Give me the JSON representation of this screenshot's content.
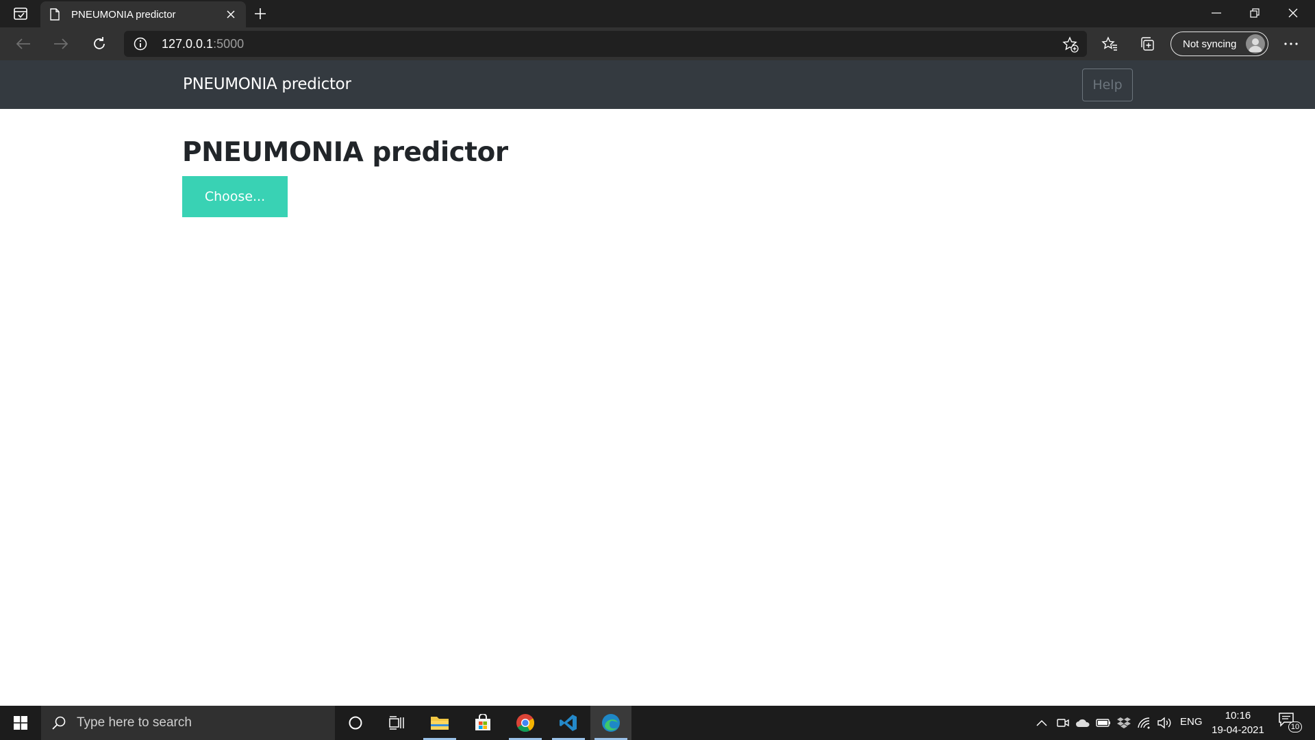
{
  "browser": {
    "tab": {
      "title": "PNEUMONIA predictor"
    },
    "address": {
      "host": "127.0.0.1",
      "port": ":5000"
    },
    "profile": {
      "label": "Not syncing"
    }
  },
  "page": {
    "navbar": {
      "brand": "PNEUMONIA predictor",
      "help_label": "Help"
    },
    "heading": "PNEUMONIA predictor",
    "choose_label": "Choose..."
  },
  "taskbar": {
    "search_placeholder": "Type here to search",
    "apps": [
      "cortana-icon",
      "task-view-icon",
      "file-explorer-icon",
      "store-icon",
      "chrome-icon",
      "vscode-icon",
      "edge-icon"
    ],
    "language": "ENG",
    "time": "10:16",
    "date": "19-04-2021",
    "notification_count": "10"
  },
  "colors": {
    "navbar_bg": "#343a40",
    "choose_button_bg": "#39d2b4",
    "heading_text": "#212529",
    "help_button": "#6c757d"
  }
}
